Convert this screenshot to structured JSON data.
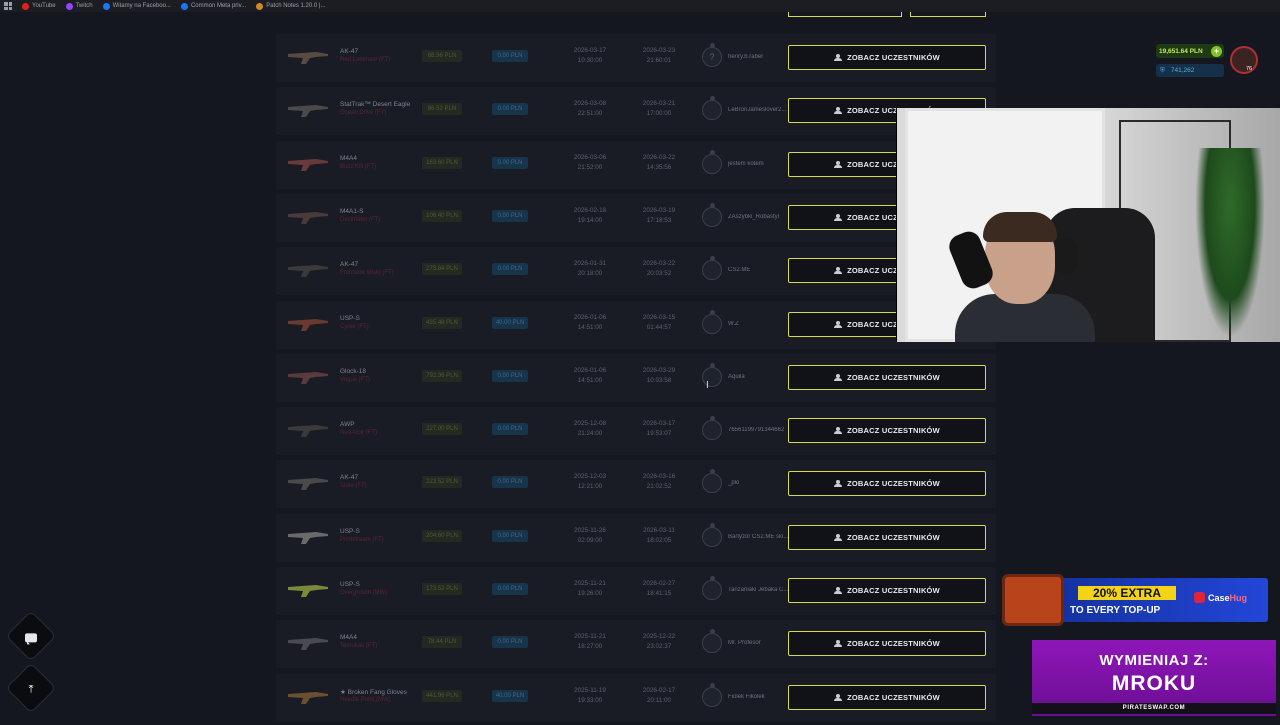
{
  "bookmarks": [
    {
      "label": "YouTube",
      "color": "#e02020"
    },
    {
      "label": "Twitch",
      "color": "#9146ff"
    },
    {
      "label": "Witamy na Faceboo...",
      "color": "#1877f2"
    },
    {
      "label": "Common Meta priv...",
      "color": "#1877f2"
    },
    {
      "label": "Patch Notes 1.20.0 |...",
      "color": "#d08a20"
    }
  ],
  "user": {
    "balance": "19,651.64 PLN",
    "coins": "741,262",
    "level": "76"
  },
  "button_label": "ZOBACZ UCZESTNIKÓW",
  "rows": [
    {
      "weapon": "AK-47",
      "skin": "Red Laminate (FT)",
      "price": "68.96 PLN",
      "fee": "0.00 PLN",
      "start_date": "2026-03-17",
      "start_time": "10:30:00",
      "end_date": "2026-03-23",
      "end_time": "21:60:01",
      "winner": "henry.b.raber",
      "avatar": "?"
    },
    {
      "weapon": "StatTrak™ Desert Eagle",
      "skin": "Ocean Drive (FT)",
      "price": "86.52 PLN",
      "fee": "0.00 PLN",
      "start_date": "2026-03-08",
      "start_time": "22:51:00",
      "end_date": "2026-03-21",
      "end_time": "17:00:00",
      "winner": "LeBronJameslover2...",
      "avatar": ""
    },
    {
      "weapon": "M4A4",
      "skin": "Buzz Kill (FT)",
      "price": "163.60 PLN",
      "fee": "0.00 PLN",
      "start_date": "2026-03-06",
      "start_time": "21:52:00",
      "end_date": "2026-03-22",
      "end_time": "14:35:56",
      "winner": "jestem kotem",
      "avatar": ""
    },
    {
      "weapon": "M4A1-S",
      "skin": "Decimator (FT)",
      "price": "106.40 PLN",
      "fee": "0.00 PLN",
      "start_date": "2026-02-18",
      "start_time": "19:14:00",
      "end_date": "2026-03-19",
      "end_time": "17:18:53",
      "winner": "ZAszybki_Robastyl",
      "avatar": ""
    },
    {
      "weapon": "AK-47",
      "skin": "Frontside Misty (FT)",
      "price": "273.84 PLN",
      "fee": "0.00 PLN",
      "start_date": "2026-01-31",
      "start_time": "20:18:00",
      "end_date": "2026-03-22",
      "end_time": "20:03:52",
      "winner": "CS2.ME",
      "avatar": ""
    },
    {
      "weapon": "USP-S",
      "skin": "Cyrex (FT)",
      "price": "435.48 PLN",
      "fee": "40.00 PLN",
      "start_date": "2026-01-06",
      "start_time": "14:51:00",
      "end_date": "2026-03-15",
      "end_time": "01:44:57",
      "winner": "W.Z",
      "avatar": ""
    },
    {
      "weapon": "Glock-18",
      "skin": "Vogue (FT)",
      "price": "792.36 PLN",
      "fee": "0.00 PLN",
      "start_date": "2026-01-06",
      "start_time": "14:51:00",
      "end_date": "2026-03-29",
      "end_time": "10:03:58",
      "winner": "Aquila",
      "avatar": ""
    },
    {
      "weapon": "AWP",
      "skin": "Neo-Noir (FT)",
      "price": "227.00 PLN",
      "fee": "0.00 PLN",
      "start_date": "2025-12-08",
      "start_time": "21:24:00",
      "end_date": "2026-03-17",
      "end_time": "19:53:07",
      "winner": "76561199791344662",
      "avatar": ""
    },
    {
      "weapon": "AK-47",
      "skin": "Slate (FT)",
      "price": "223.52 PLN",
      "fee": "0.00 PLN",
      "start_date": "2025-12-03",
      "start_time": "12:21:00",
      "end_date": "2026-03-16",
      "end_time": "21:02:52",
      "winner": "_plo",
      "avatar": ""
    },
    {
      "weapon": "USP-S",
      "skin": "Printstream (FT)",
      "price": "204.60 PLN",
      "fee": "0.00 PLN",
      "start_date": "2025-11-26",
      "start_time": "02:09:00",
      "end_date": "2026-03-11",
      "end_time": "18:02:05",
      "winner": "Bartyzor CS2.ME ski...",
      "avatar": ""
    },
    {
      "weapon": "USP-S",
      "skin": "Overgrowth (MW)",
      "price": "173.52 PLN",
      "fee": "0.00 PLN",
      "start_date": "2025-11-21",
      "start_time": "19:26:00",
      "end_date": "2026-02-27",
      "end_time": "18:41:15",
      "winner": "Tanzaniaki Jebaka C...",
      "avatar": ""
    },
    {
      "weapon": "M4A4",
      "skin": "Temukau (FT)",
      "price": "78.44 PLN",
      "fee": "0.00 PLN",
      "start_date": "2025-11-21",
      "start_time": "18:27:00",
      "end_date": "2025-12-22",
      "end_time": "23:02:37",
      "winner": "Mr. Profesor",
      "avatar": ""
    },
    {
      "weapon": "★ Broken Fang Gloves",
      "skin": "Needle Point (MW)",
      "price": "441.96 PLN",
      "fee": "40.00 PLN",
      "start_date": "2025-11-19",
      "start_time": "19:33:00",
      "end_date": "2026-02-17",
      "end_time": "20:11:00",
      "winner": "Fiolek Fikolek",
      "avatar": ""
    }
  ],
  "ads": {
    "casehug": {
      "extra": "20% EXTRA",
      "sub": "TO EVERY TOP-UP",
      "brand1": "Case",
      "brand2": "Hug"
    },
    "pirateswap": {
      "line1": "WYMIENIAJ Z:",
      "line2": "MROKU",
      "footer": "PIRATESWAP.COM"
    }
  }
}
